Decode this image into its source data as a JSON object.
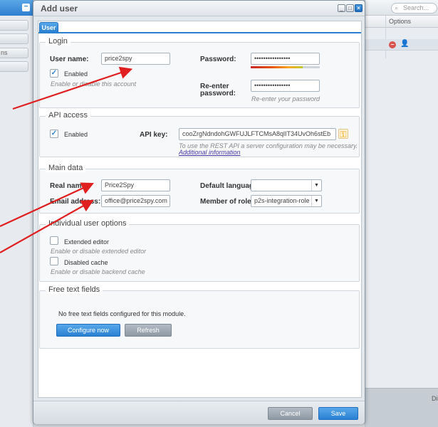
{
  "background": {
    "left_buttons": [
      "",
      "",
      "ns",
      ""
    ],
    "search_placeholder": "Search...",
    "column_header": "Options",
    "bottom_text": "Di"
  },
  "dialog": {
    "title": "Add user",
    "tab": "User",
    "login": {
      "legend": "Login",
      "username_label": "User name:",
      "username_value": "price2spy",
      "enabled_label": "Enabled",
      "enabled_checked": true,
      "enabled_hint": "Enable or disable this account",
      "password_label": "Password:",
      "password_value": "••••••••••••••••",
      "password_strength": 0.75,
      "reenter_label_1": "Re-enter",
      "reenter_label_2": "password:",
      "reenter_value": "••••••••••••••••",
      "reenter_hint": "Re-enter your password"
    },
    "api": {
      "legend": "API access",
      "enabled_label": "Enabled",
      "enabled_checked": true,
      "key_label": "API key:",
      "key_value": "cooZrgNdndohGWFUJLFTCMsA8qlIT34UvOh6stEb",
      "hint": "To use the REST API a server configuration may be necessary.",
      "link": "Additional information"
    },
    "main": {
      "legend": "Main data",
      "realname_label": "Real name:",
      "realname_value": "Price2Spy",
      "email_label": "Email address:",
      "email_value": "office@price2spy.com",
      "language_label": "Default language:",
      "language_value": "",
      "role_label": "Member of role:",
      "role_value": "p2s-integration-role"
    },
    "options": {
      "legend": "Individual user options",
      "extended_label": "Extended editor",
      "extended_hint": "Enable or disable extended editor",
      "cache_label": "Disabled cache",
      "cache_hint": "Enable or disable backend cache"
    },
    "free_text": {
      "legend": "Free text fields",
      "message": "No free text fields configured for this module.",
      "configure_label": "Configure now",
      "refresh_label": "Refresh"
    },
    "footer": {
      "cancel_label": "Cancel",
      "save_label": "Save"
    }
  },
  "colors": {
    "accent": "#2a80d2",
    "arrow": "#e02020"
  }
}
